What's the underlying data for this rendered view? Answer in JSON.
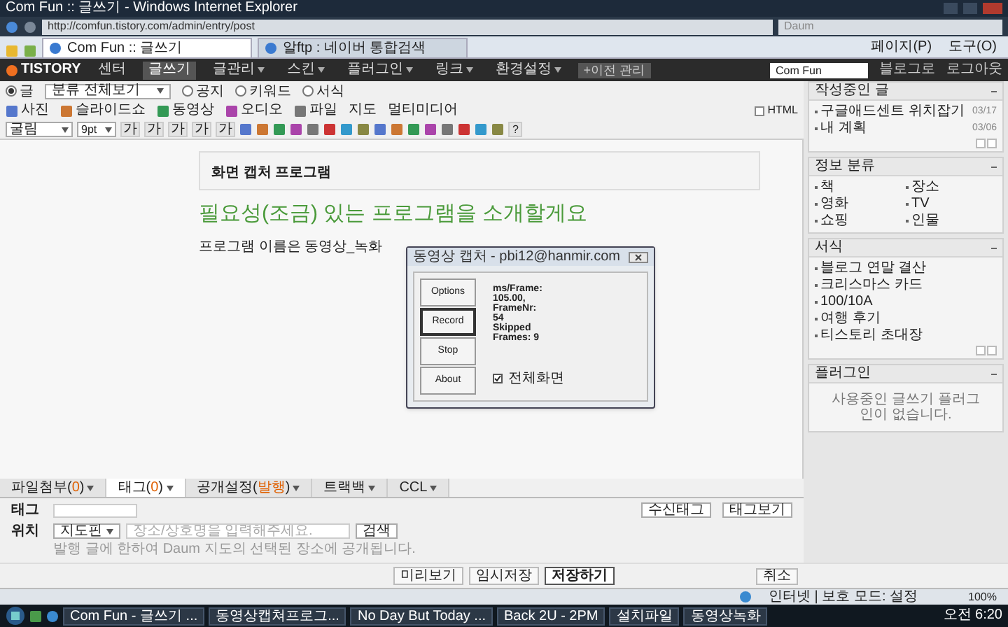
{
  "window": {
    "title": "Com Fun :: 글쓰기 - Windows Internet Explorer"
  },
  "address_bar": {
    "url": "http://comfun.tistory.com/admin/entry/post",
    "search_placeholder": "Daum"
  },
  "browser_tabs": [
    {
      "label": "Com Fun :: 글쓰기",
      "selected": true
    },
    {
      "label": "알ftp : 네이버 통합검색",
      "selected": false
    }
  ],
  "command_bar": [
    "페이지(P)",
    "도구(O)"
  ],
  "tistory_nav": {
    "logo": "TISTORY",
    "items": [
      {
        "label": "센터",
        "selected": false,
        "dropdown": false
      },
      {
        "label": "글쓰기",
        "selected": true,
        "dropdown": false
      },
      {
        "label": "글관리",
        "selected": false,
        "dropdown": true
      },
      {
        "label": "스킨",
        "selected": false,
        "dropdown": true
      },
      {
        "label": "플러그인",
        "selected": false,
        "dropdown": true
      },
      {
        "label": "링크",
        "selected": false,
        "dropdown": true
      },
      {
        "label": "환경설정",
        "selected": false,
        "dropdown": true
      }
    ],
    "extra": "+이전 관리",
    "blog_select": "Com Fun",
    "links": [
      "블로그로",
      "로그아웃"
    ]
  },
  "post_type": {
    "category": "분류 전체보기",
    "options": [
      {
        "label": "글",
        "selected": true
      },
      {
        "label": "공지",
        "selected": false
      },
      {
        "label": "키워드",
        "selected": false
      },
      {
        "label": "서식",
        "selected": false
      }
    ]
  },
  "media": [
    "사진",
    "슬라이드쇼",
    "동영상",
    "오디오",
    "파일",
    "지도",
    "멀티미디어"
  ],
  "html_toggle": {
    "label": "HTML",
    "checked": false
  },
  "format_bar": {
    "font": "굴림",
    "size": "9pt",
    "text_buttons": [
      "가",
      "가",
      "가",
      "가",
      "가"
    ],
    "help": "?"
  },
  "editor": {
    "box_title": "화면 캡처 프로그램",
    "heading": "필요성(조금) 있는 프로그램을 소개할게요",
    "paragraph": "프로그램 이름은 동영상_녹화"
  },
  "dialog": {
    "title": "동영상 캡처 - pbi12@hanmir.com",
    "buttons": [
      {
        "label": "Options",
        "selected": false
      },
      {
        "label": "Record",
        "selected": true
      },
      {
        "label": "Stop",
        "selected": false
      },
      {
        "label": "About",
        "selected": false
      }
    ],
    "stats": [
      "ms/Frame:",
      "105.00,",
      "FrameNr:",
      "54",
      "Skipped",
      "Frames: 9"
    ],
    "fullscreen": {
      "label": "전체화면",
      "checked": true
    }
  },
  "sidebar": {
    "panels": [
      {
        "title": "작성중인 글",
        "kind": "list",
        "items": [
          {
            "label": "구글애드센트 위치잡기",
            "date": "03/17"
          },
          {
            "label": "내 계획",
            "date": "03/06"
          }
        ],
        "pager": true
      },
      {
        "title": "정보 분류",
        "kind": "grid",
        "items": [
          {
            "label": "책"
          },
          {
            "label": "장소"
          },
          {
            "label": "영화"
          },
          {
            "label": "TV"
          },
          {
            "label": "쇼핑"
          },
          {
            "label": "인물"
          }
        ],
        "pager": false
      },
      {
        "title": "서식",
        "kind": "list",
        "items": [
          {
            "label": "블로그 연말 결산"
          },
          {
            "label": "크리스마스 카드"
          },
          {
            "label": "100/10A"
          },
          {
            "label": "여행 후기"
          },
          {
            "label": "티스토리 초대장"
          }
        ],
        "pager": true
      },
      {
        "title": "플러그인",
        "kind": "message",
        "message": "사용중인 글쓰기 플러그인이 없습니다.",
        "pager": false
      }
    ]
  },
  "bottom_tabs": [
    {
      "label": "파일첨부(**0**)",
      "selected": false
    },
    {
      "label": "태그(**0**)",
      "selected": true
    },
    {
      "label": "공개설정(**발행**)",
      "selected": false
    },
    {
      "label": "트랙백",
      "selected": false
    },
    {
      "label": "CCL",
      "selected": false
    }
  ],
  "tag_panel": {
    "tag_label": "태그",
    "location_label": "위치",
    "map_select": "지도핀",
    "place_placeholder": "장소/상호명을 입력해주세요.",
    "search_button": "검색",
    "note": "발행 글에 한하여 Daum 지도의 선택된 장소에 공개됩니다.",
    "buttons": [
      "수신태그",
      "태그보기"
    ]
  },
  "actions": [
    {
      "label": "미리보기",
      "primary": false
    },
    {
      "label": "임시저장",
      "primary": false
    },
    {
      "label": "저장하기",
      "primary": true
    }
  ],
  "cancel": "취소",
  "status_bar": {
    "zone": "인터넷 | 보호 모드: 설정",
    "zoom": "100%"
  },
  "taskbar": {
    "items": [
      "Com Fun - 글쓰기 ...",
      "동영상캡쳐프로그...",
      "No Day But Today ...",
      "Back 2U - 2PM",
      "설치파일",
      "동영상녹화"
    ],
    "clock": "오전 6:20"
  }
}
